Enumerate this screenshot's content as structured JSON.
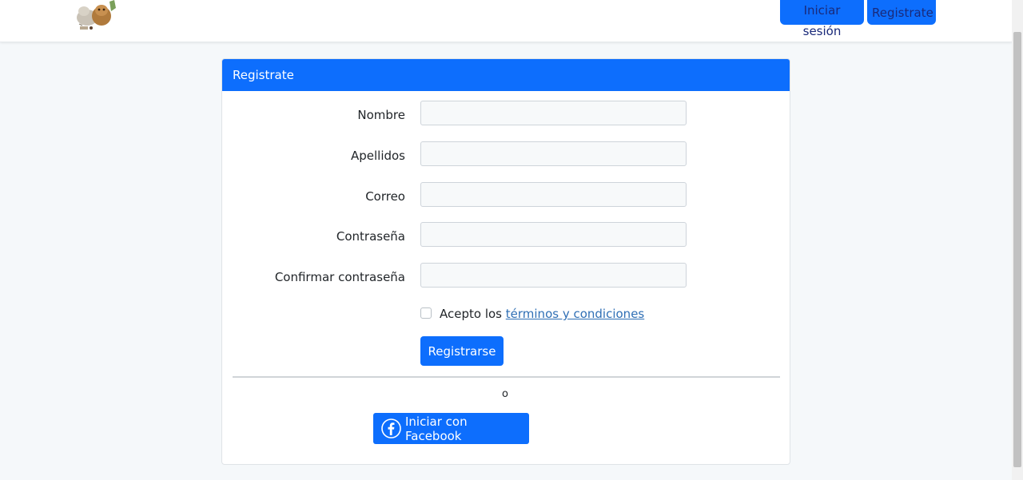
{
  "navbar": {
    "login_label": "Iniciar sesión",
    "register_label": "Registrate"
  },
  "card": {
    "title": "Registrate"
  },
  "form": {
    "fields": [
      {
        "label": "Nombre",
        "value": "",
        "placeholder": ""
      },
      {
        "label": "Apellidos",
        "value": "",
        "placeholder": ""
      },
      {
        "label": "Correo",
        "value": "",
        "placeholder": ""
      },
      {
        "label": "Contraseña",
        "value": "",
        "placeholder": ""
      },
      {
        "label": "Confirmar contraseña",
        "value": "",
        "placeholder": ""
      }
    ],
    "terms_prefix": "Acepto los",
    "terms_link": "términos y condiciones",
    "submit_label": "Registrarse"
  },
  "alt": {
    "or_text": "o",
    "facebook_label": "Iniciar con Facebook"
  },
  "colors": {
    "primary": "#0d6efd",
    "link": "#2f6fb5",
    "background": "#f5f8fa"
  }
}
